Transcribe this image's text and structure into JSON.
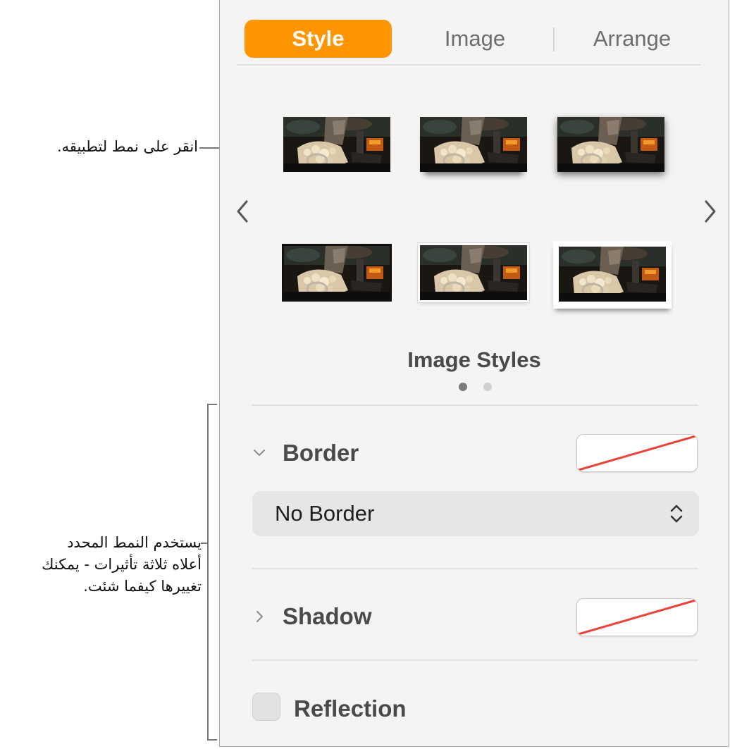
{
  "callouts": {
    "apply_style": "انقر على نمط لتطبيقه.",
    "effects_lines": [
      "يستخدم النمط المحدد",
      "أعلاه ثلاثة تأثيرات - يمكنك",
      "تغييرها كيفما شئت."
    ]
  },
  "tabs": [
    {
      "label": "Style",
      "active": true
    },
    {
      "label": "Image",
      "active": false
    },
    {
      "label": "Arrange",
      "active": false
    }
  ],
  "image_styles": {
    "title": "Image Styles",
    "page_count": 2,
    "current_page": 1,
    "thumbnail_count": 6
  },
  "border": {
    "label": "Border",
    "expanded": true,
    "color_swatch": "none",
    "style_value": "No Border"
  },
  "shadow": {
    "label": "Shadow",
    "expanded": false,
    "color_swatch": "none"
  },
  "reflection": {
    "label": "Reflection",
    "checked": false
  },
  "colors": {
    "accent": "#ff9500",
    "panel_bg": "#f5f4f3",
    "no_color_slash": "#e8443a"
  },
  "icons": {
    "prev": "chevron-left-icon",
    "next": "chevron-right-icon",
    "border_disclosure": "chevron-down-icon",
    "shadow_disclosure": "chevron-right-icon",
    "select_arrows": "chevron-up-down-icon"
  }
}
